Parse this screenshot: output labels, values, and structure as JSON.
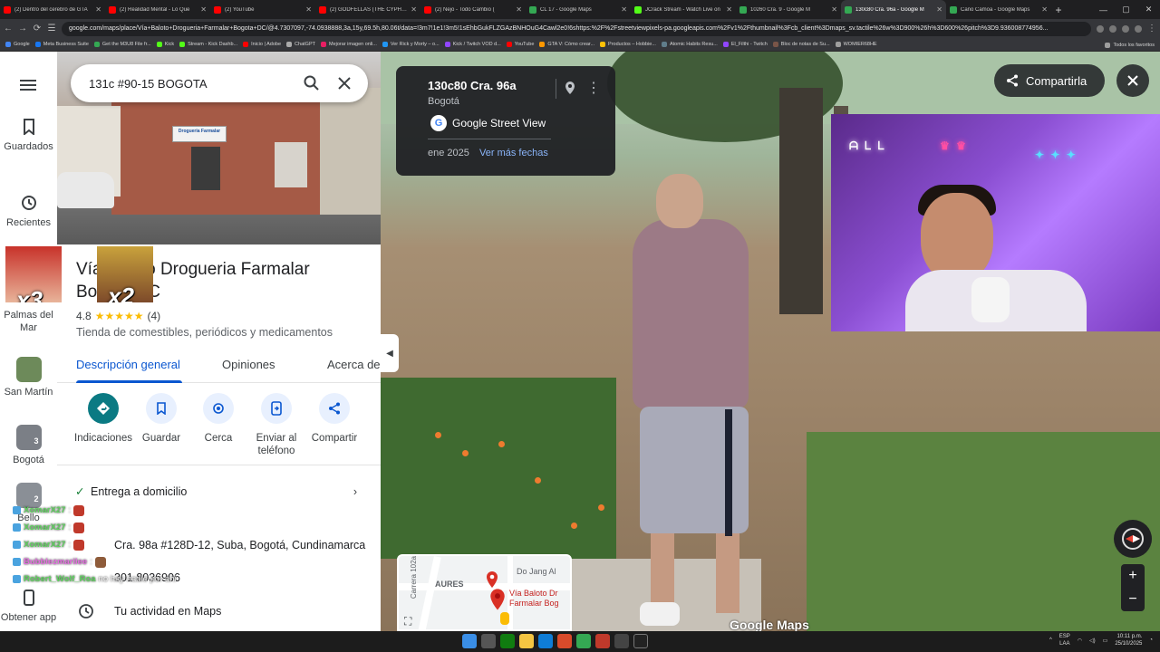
{
  "browser": {
    "tabs": [
      {
        "title": "(2) Dentro del cerebro de GTA",
        "color": "#ff0000"
      },
      {
        "title": "(2) Realidad Mental - Lo Que",
        "color": "#ff0000"
      },
      {
        "title": "(2) YouTube",
        "color": "#ff0000"
      },
      {
        "title": "(2) GODFELLAS (THE CYPHER)",
        "color": "#ff0000"
      },
      {
        "title": "(2) Ñejo - Todo Cambio (",
        "color": "#ff0000"
      },
      {
        "title": "CL 17 - Google Maps",
        "color": "#34a853"
      },
      {
        "title": "JCrack Stream - Watch Live on",
        "color": "#53fc18"
      },
      {
        "title": "10260 Cra. 9 - Google M",
        "color": "#34a853"
      },
      {
        "title": "130c80 Cra. 96a - Google M",
        "color": "#34a853"
      },
      {
        "title": "Caño Camoa - Google Maps",
        "color": "#34a853"
      }
    ],
    "url": "google.com/maps/place/Vía+Baloto+Drogueria+Farmalar+Bogota+DC/@4.7307097,-74.0938888,3a,15y,69.5h,80.06t/data=!3m7!1e1!3m5!1sEhbGukFLZGAzBNHOuG4Cawl2e0!6shttps:%2F%2Fstreetviewpixels-pa.googleapis.com%2Fv1%2Fthumbnail%3Fcb_client%3Dmaps_sv.tactile%26w%3D900%26h%3D600%26pitch%3D9.936008774956...",
    "bookmarks": [
      {
        "label": "Google",
        "color": "#4285f4"
      },
      {
        "label": "Meta Business Suite",
        "color": "#1877f2"
      },
      {
        "label": "Get the M3U8 File fr...",
        "color": "#34a853"
      },
      {
        "label": "Kick",
        "color": "#53fc18"
      },
      {
        "label": "Stream - Kick Dashb...",
        "color": "#53fc18"
      },
      {
        "label": "Inicio | Adobe",
        "color": "#ff0000"
      },
      {
        "label": "ChatGPT",
        "color": "#aaaaaa"
      },
      {
        "label": "Mejorar imagen onli...",
        "color": "#e91e63"
      },
      {
        "label": "Ver Rick y Morty – o...",
        "color": "#2196f3"
      },
      {
        "label": "Kick / Twitch VOD d...",
        "color": "#9146ff"
      },
      {
        "label": "YouTube",
        "color": "#ff0000"
      },
      {
        "label": "GTA V: Cómo crear...",
        "color": "#ff9800"
      },
      {
        "label": "Productos – Hobbie...",
        "color": "#ffc107"
      },
      {
        "label": "Atomic Habits Resu...",
        "color": "#607d8b"
      },
      {
        "label": "El_Filthi - Twitch",
        "color": "#9146ff"
      },
      {
        "label": "Bloc de notas de Su...",
        "color": "#795548"
      },
      {
        "label": "WOMIER68HE",
        "color": "#9e9e9e"
      }
    ],
    "bookmarks_all": "Todos los favoritos"
  },
  "rail": {
    "saved": "Guardados",
    "recents": "Recientes",
    "recent_items": [
      {
        "label": "Palmas del Mar",
        "badge": ""
      },
      {
        "label": "San Martín",
        "badge": ""
      },
      {
        "label": "Bogotá",
        "badge": "3"
      },
      {
        "label": "Bello",
        "badge": "2"
      }
    ],
    "get_app": "Obtener app"
  },
  "panel": {
    "search_query": "131c #90-15 BOGOTA",
    "photo_sign": "Drogueria Farmalar",
    "title": "Vía Baloto Drogueria Farmalar Bogota DC",
    "rating": "4.8",
    "stars": "★★★★★",
    "reviews": "(4)",
    "category": "Tienda de comestibles, periódicos y medicamentos",
    "tabs": [
      "Descripción general",
      "Opiniones",
      "Acerca de"
    ],
    "actions": [
      "Indicaciones",
      "Guardar",
      "Cerca",
      "Enviar al teléfono",
      "Compartir"
    ],
    "delivery": "Entrega a domicilio",
    "address": "Cra. 98a #128D-12, Suba, Bogotá, Cundinamarca",
    "phone": "301 8036906",
    "activity": "Tu actividad en Maps"
  },
  "streetview": {
    "address": "130c80 Cra. 96a",
    "city": "Bogotá",
    "source": "Google Street View",
    "date": "ene 2025",
    "more_dates": "Ver más fechas",
    "share": "Compartirla",
    "logo": "Google Maps",
    "minimap": {
      "street1": "AURES",
      "street2": "Carrera 102a",
      "street3": "Do Jang Al",
      "poi": "Vía Baloto Dr Farmalar Bog"
    }
  },
  "overlay": {
    "meme1": "x3",
    "meme2": "x2",
    "chat": [
      {
        "name": "XomarX27",
        "msg": ":",
        "style": "green"
      },
      {
        "name": "XomarX27",
        "msg": ":",
        "style": "green"
      },
      {
        "name": "XomarX27",
        "msg": ":",
        "style": "green"
      },
      {
        "name": "Bubblezmarilee",
        "msg": ":",
        "style": "pink"
      },
      {
        "name": "Robert_Wolf_Roa",
        "msg": "no hay nadie por ahi",
        "style": "green"
      }
    ]
  },
  "taskbar": {
    "lang": "ESP",
    "lang2": "LAA",
    "time": "10:11 p.m.",
    "date": "25/10/2025"
  }
}
